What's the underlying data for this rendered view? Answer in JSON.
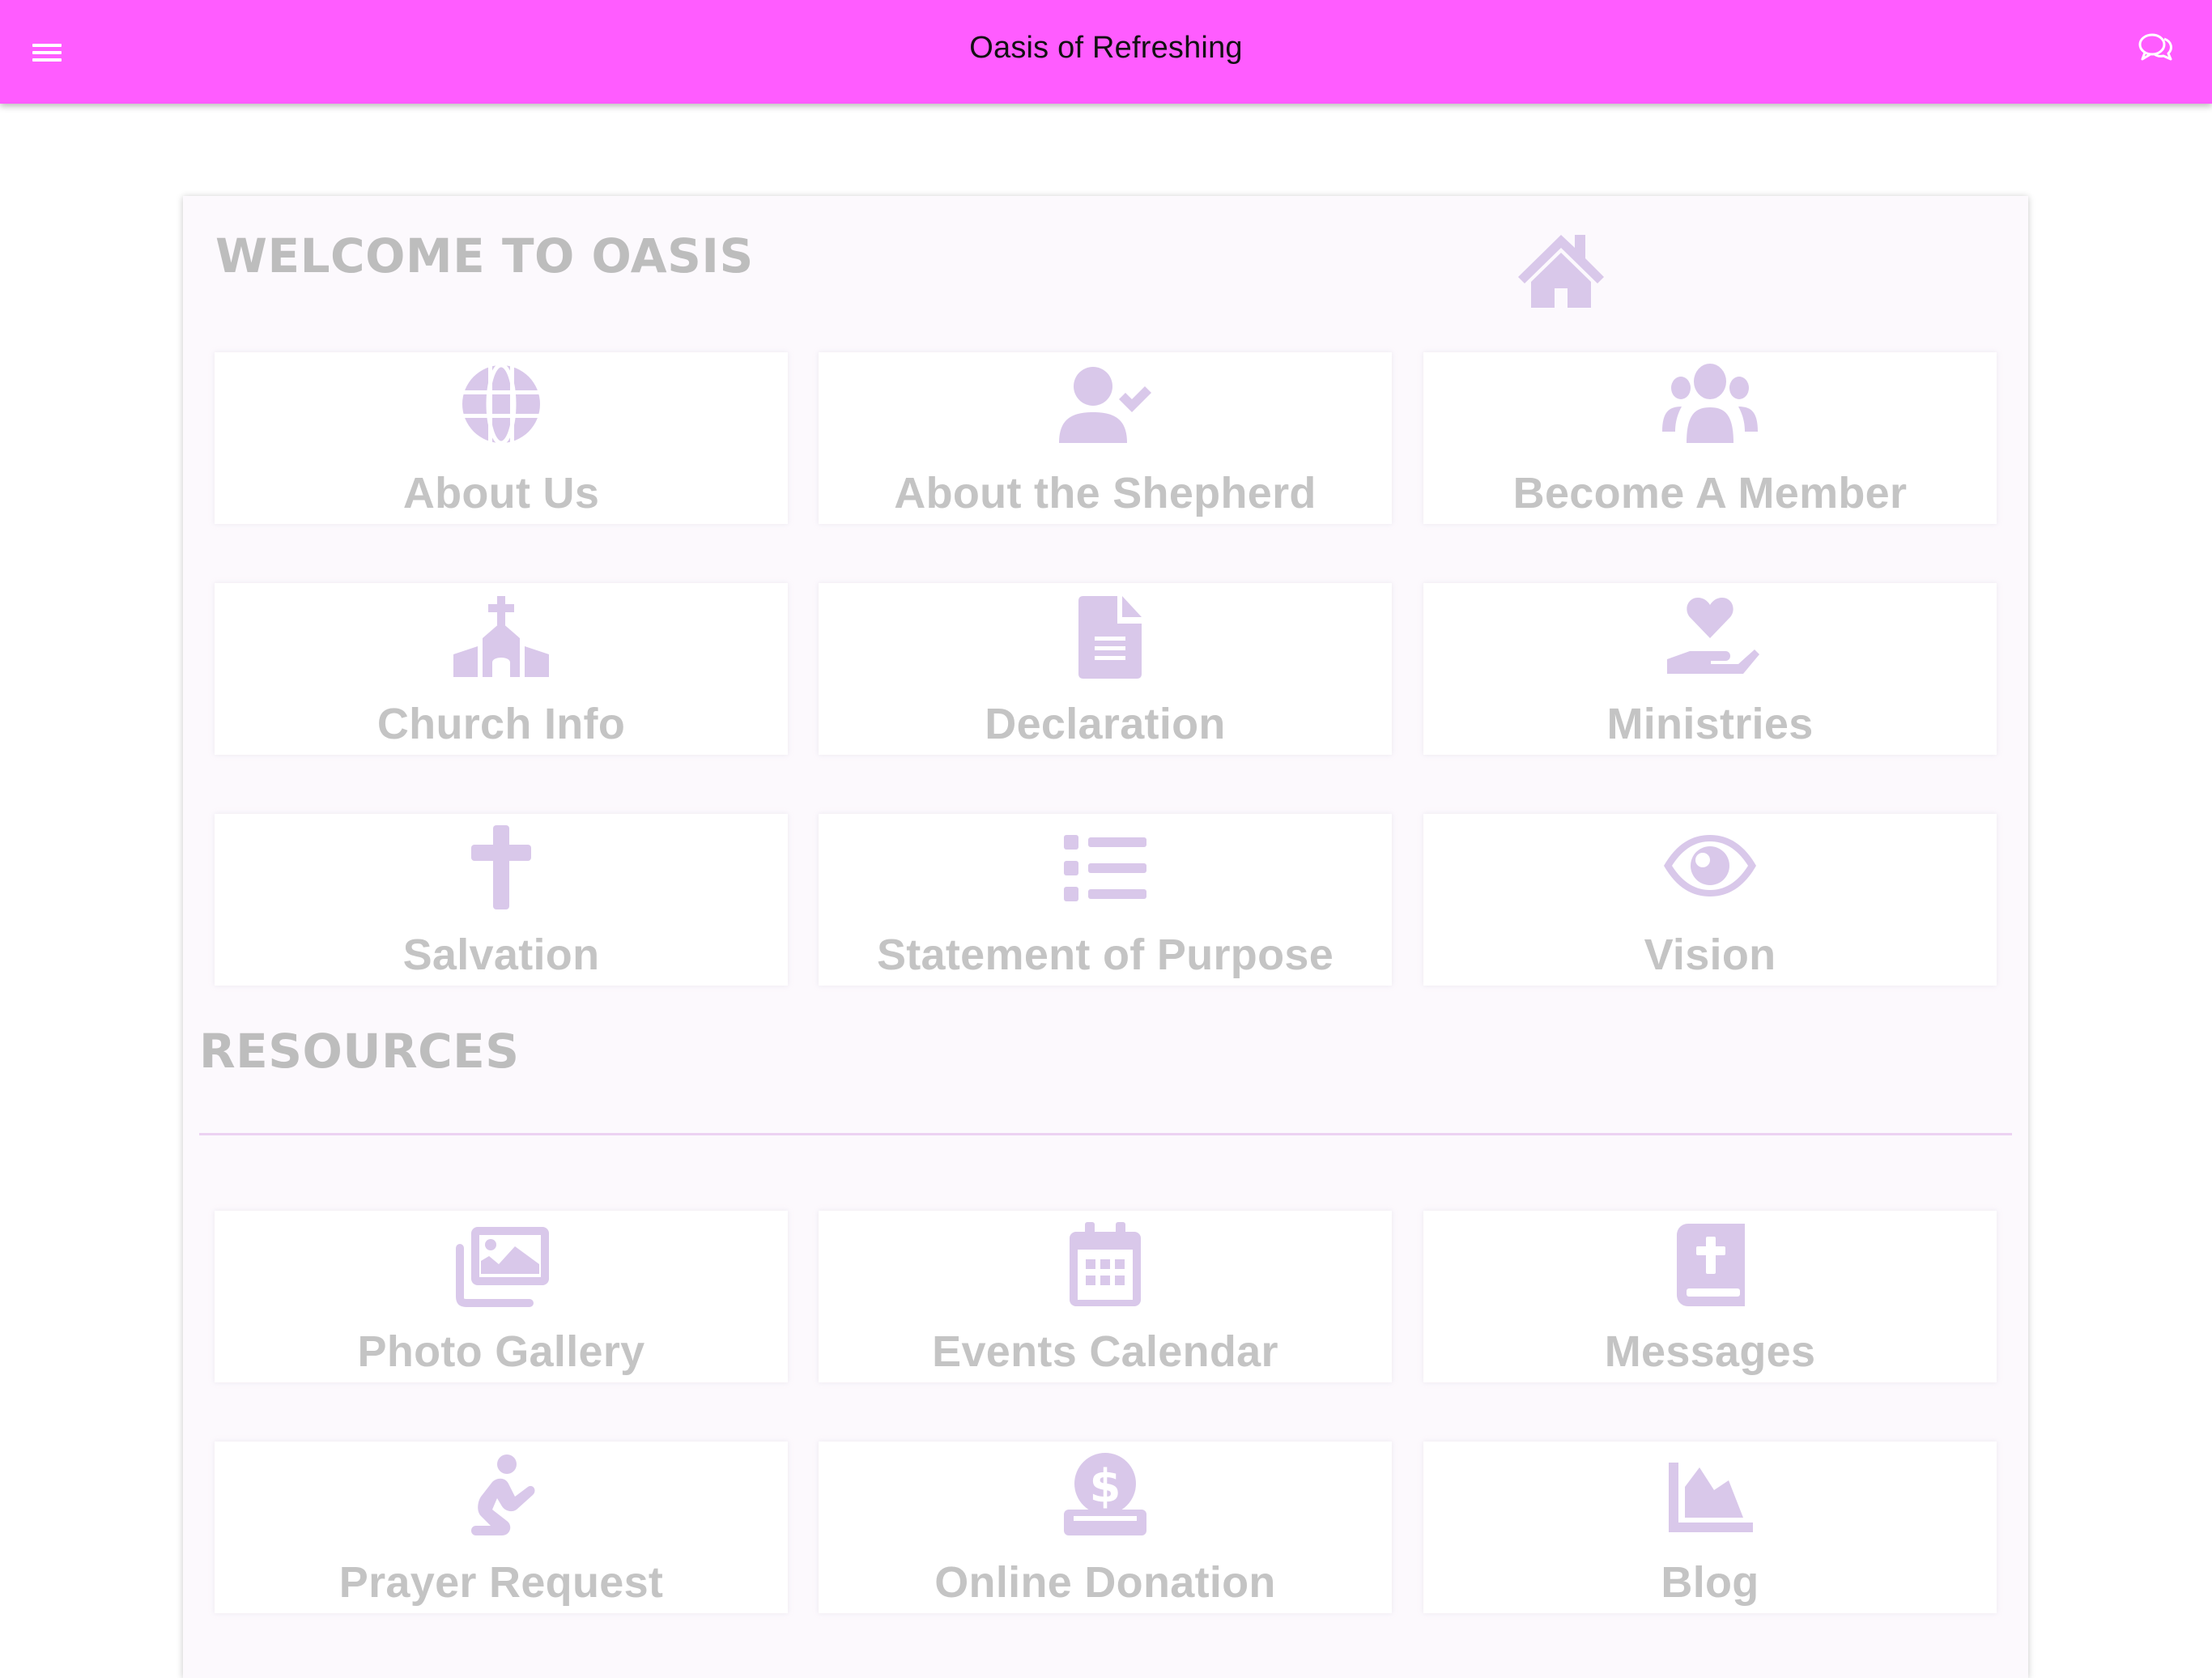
{
  "app": {
    "title": "Oasis of Refreshing",
    "menu_icon": "hamburger-menu-icon",
    "chat_icon": "chat-bubbles-icon",
    "brand_color": "#ff5cff",
    "icon_color": "#d9c8ea"
  },
  "welcome": {
    "title": "WELCOME TO OASIS",
    "icon": "home-icon",
    "tiles": [
      {
        "label": "About Us",
        "icon": "globe-icon"
      },
      {
        "label": "About the Shepherd",
        "icon": "user-check-icon"
      },
      {
        "label": "Become A Member",
        "icon": "users-group-icon"
      },
      {
        "label": "Church Info",
        "icon": "church-icon"
      },
      {
        "label": "Declaration",
        "icon": "document-icon"
      },
      {
        "label": "Ministries",
        "icon": "hand-holding-heart-icon"
      },
      {
        "label": "Salvation",
        "icon": "cross-icon"
      },
      {
        "label": "Statement of Purpose",
        "icon": "list-icon"
      },
      {
        "label": "Vision",
        "icon": "eye-icon"
      }
    ]
  },
  "resources": {
    "title": "RESOURCES",
    "tiles": [
      {
        "label": "Photo Gallery",
        "icon": "images-icon"
      },
      {
        "label": "Events Calendar",
        "icon": "calendar-icon"
      },
      {
        "label": "Messages",
        "icon": "bible-icon"
      },
      {
        "label": "Prayer Request",
        "icon": "praying-person-icon"
      },
      {
        "label": "Online Donation",
        "icon": "donate-icon"
      },
      {
        "label": "Blog",
        "icon": "area-chart-icon"
      }
    ]
  }
}
